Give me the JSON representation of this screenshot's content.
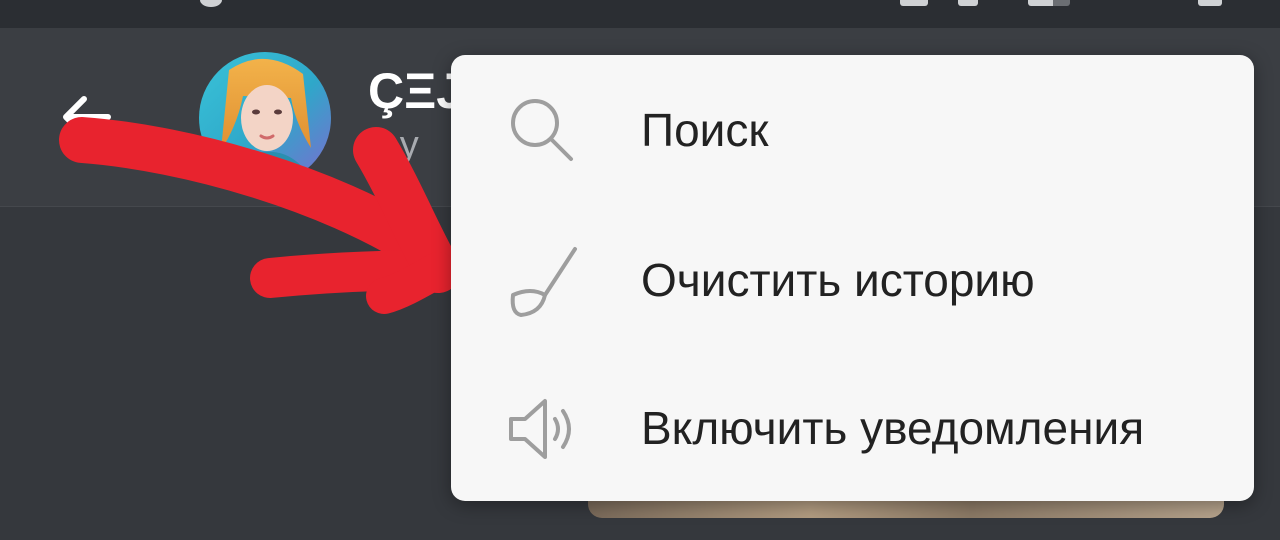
{
  "header": {
    "title": "ÇΞJ",
    "subtitle": "2 у"
  },
  "menu": {
    "items": [
      {
        "label": "Поиск",
        "icon": "search-icon"
      },
      {
        "label": "Очистить историю",
        "icon": "broom-icon"
      },
      {
        "label": "Включить уведомления",
        "icon": "speaker-icon"
      }
    ]
  },
  "colors": {
    "toolbar": "#3b3e43",
    "status_bar": "#2b2e33",
    "background": "#35383d",
    "menu_background": "#f7f7f7",
    "menu_text": "#222222",
    "menu_icon": "#9e9e9e",
    "annotation_arrow": "#e8232e"
  }
}
